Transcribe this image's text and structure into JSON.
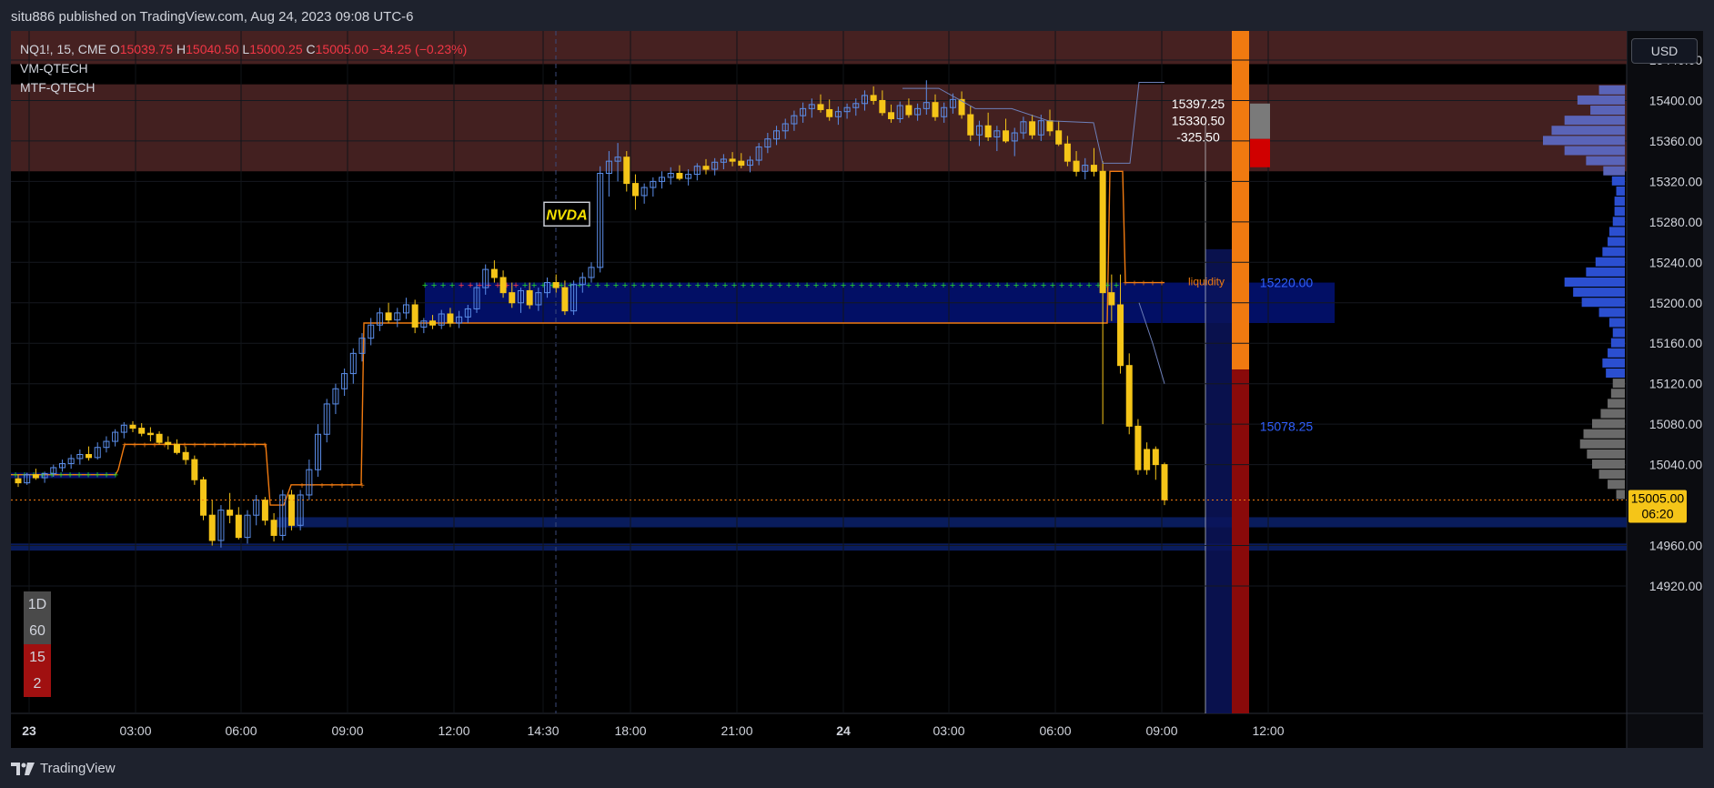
{
  "publisher": "situ886 published on TradingView.com, Aug 24, 2023 09:08 UTC-6",
  "brand": "TradingView",
  "currency_button": "USD",
  "legend": {
    "symbol": "NQ1!, 15, CME",
    "o_label": "O",
    "o": "15039.75",
    "h_label": "H",
    "h": "15040.50",
    "l_label": "L",
    "l": "15000.25",
    "c_label": "C",
    "c": "15005.00",
    "change": "−34.25 (−0.23%)",
    "ind1": "VM-QTECH",
    "ind2": "MTF-QTECH"
  },
  "timeframes": [
    "1D",
    "60",
    "15",
    "2"
  ],
  "timeframe_colors": [
    "#4a4a4a",
    "#4a4a4a",
    "#a01010",
    "#a01010"
  ],
  "colors": {
    "up": "#5b8de8",
    "down": "#f5c518",
    "red_zone": "#4a2323",
    "blue_zone": "#02106a",
    "orange": "#f07a10"
  },
  "chart_data": {
    "type": "candlestick",
    "symbol": "NQ1!",
    "interval": "15",
    "price_axis_labels": [
      "15440.00",
      "15400.00",
      "15360.00",
      "15320.00",
      "15280.00",
      "15240.00",
      "15200.00",
      "15160.00",
      "15120.00",
      "15080.00",
      "15040.00",
      "14960.00",
      "14920.00"
    ],
    "time_axis_labels": [
      "23",
      "03:00",
      "06:00",
      "09:00",
      "12:00",
      "14:30",
      "18:00",
      "21:00",
      "24",
      "03:00",
      "06:00",
      "09:00",
      "12:00"
    ],
    "ylim": [
      14910,
      15470
    ],
    "last_price": "15005.00",
    "countdown": "06:20",
    "annotations": {
      "event_label": "NVDA",
      "liquidity_label": "liquidity",
      "level_1": "15220.00",
      "level_2": "15078.25",
      "measure_top": "15397.25",
      "measure_bottom": "15330.50",
      "measure_diff": "-325.50"
    },
    "candles": [
      [
        15026,
        15030,
        15018,
        15022
      ],
      [
        15022,
        15032,
        15020,
        15030
      ],
      [
        15030,
        15036,
        15025,
        15027
      ],
      [
        15027,
        15033,
        15022,
        15031
      ],
      [
        15031,
        15040,
        15028,
        15037
      ],
      [
        15037,
        15045,
        15033,
        15041
      ],
      [
        15041,
        15050,
        15036,
        15046
      ],
      [
        15046,
        15055,
        15040,
        15050
      ],
      [
        15050,
        15058,
        15044,
        15047
      ],
      [
        15047,
        15062,
        15045,
        15057
      ],
      [
        15057,
        15068,
        15052,
        15063
      ],
      [
        15063,
        15075,
        15058,
        15072
      ],
      [
        15072,
        15082,
        15066,
        15079
      ],
      [
        15079,
        15083,
        15072,
        15076
      ],
      [
        15076,
        15081,
        15068,
        15071
      ],
      [
        15071,
        15077,
        15063,
        15070
      ],
      [
        15070,
        15073,
        15060,
        15062
      ],
      [
        15062,
        15068,
        15055,
        15060
      ],
      [
        15060,
        15065,
        15050,
        15052
      ],
      [
        15052,
        15058,
        15040,
        15045
      ],
      [
        15045,
        15049,
        15020,
        15025
      ],
      [
        15025,
        15028,
        14985,
        14990
      ],
      [
        14990,
        15005,
        14960,
        14965
      ],
      [
        14965,
        15000,
        14958,
        14995
      ],
      [
        14995,
        15012,
        14982,
        14990
      ],
      [
        14990,
        14998,
        14966,
        14968
      ],
      [
        14968,
        14995,
        14962,
        14990
      ],
      [
        14990,
        15010,
        14980,
        15005
      ],
      [
        15005,
        15008,
        14980,
        14985
      ],
      [
        14985,
        14992,
        14964,
        14970
      ],
      [
        14970,
        15015,
        14965,
        15010
      ],
      [
        15010,
        15015,
        14975,
        14980
      ],
      [
        14980,
        15015,
        14975,
        15010
      ],
      [
        15010,
        15045,
        15005,
        15035
      ],
      [
        15035,
        15080,
        15028,
        15070
      ],
      [
        15070,
        15105,
        15062,
        15100
      ],
      [
        15100,
        15120,
        15090,
        15115
      ],
      [
        15115,
        15135,
        15108,
        15130
      ],
      [
        15130,
        15155,
        15120,
        15150
      ],
      [
        15150,
        15170,
        15142,
        15165
      ],
      [
        15165,
        15185,
        15158,
        15178
      ],
      [
        15178,
        15195,
        15172,
        15190
      ],
      [
        15190,
        15200,
        15180,
        15183
      ],
      [
        15183,
        15195,
        15176,
        15190
      ],
      [
        15190,
        15205,
        15184,
        15198
      ],
      [
        15198,
        15203,
        15170,
        15176
      ],
      [
        15176,
        15185,
        15170,
        15182
      ],
      [
        15182,
        15188,
        15174,
        15178
      ],
      [
        15178,
        15193,
        15174,
        15189
      ],
      [
        15189,
        15195,
        15176,
        15180
      ],
      [
        15180,
        15192,
        15175,
        15186
      ],
      [
        15186,
        15198,
        15180,
        15194
      ],
      [
        15194,
        15220,
        15190,
        15215
      ],
      [
        15215,
        15238,
        15208,
        15233
      ],
      [
        15233,
        15242,
        15220,
        15225
      ],
      [
        15225,
        15232,
        15205,
        15210
      ],
      [
        15210,
        15220,
        15195,
        15200
      ],
      [
        15200,
        15215,
        15190,
        15212
      ],
      [
        15212,
        15220,
        15194,
        15198
      ],
      [
        15198,
        15215,
        15192,
        15210
      ],
      [
        15210,
        15225,
        15205,
        15220
      ],
      [
        15220,
        15228,
        15210,
        15215
      ],
      [
        15215,
        15222,
        15188,
        15192
      ],
      [
        15192,
        15222,
        15188,
        15218
      ],
      [
        15218,
        15230,
        15210,
        15225
      ],
      [
        15225,
        15240,
        15220,
        15235
      ],
      [
        15235,
        15335,
        15230,
        15328
      ],
      [
        15328,
        15350,
        15305,
        15340
      ],
      [
        15340,
        15358,
        15320,
        15344
      ],
      [
        15344,
        15350,
        15310,
        15318
      ],
      [
        15318,
        15327,
        15292,
        15306
      ],
      [
        15306,
        15318,
        15298,
        15314
      ],
      [
        15314,
        15324,
        15305,
        15320
      ],
      [
        15320,
        15330,
        15313,
        15324
      ],
      [
        15324,
        15334,
        15317,
        15328
      ],
      [
        15328,
        15336,
        15321,
        15323
      ],
      [
        15323,
        15332,
        15316,
        15327
      ],
      [
        15327,
        15338,
        15321,
        15335
      ],
      [
        15335,
        15342,
        15327,
        15332
      ],
      [
        15332,
        15343,
        15326,
        15339
      ],
      [
        15339,
        15347,
        15332,
        15342
      ],
      [
        15342,
        15349,
        15335,
        15340
      ],
      [
        15340,
        15348,
        15333,
        15336
      ],
      [
        15336,
        15345,
        15329,
        15341
      ],
      [
        15341,
        15358,
        15336,
        15354
      ],
      [
        15354,
        15368,
        15348,
        15362
      ],
      [
        15362,
        15375,
        15356,
        15370
      ],
      [
        15370,
        15382,
        15362,
        15377
      ],
      [
        15377,
        15390,
        15370,
        15385
      ],
      [
        15385,
        15398,
        15378,
        15392
      ],
      [
        15392,
        15402,
        15383,
        15396
      ],
      [
        15396,
        15406,
        15388,
        15391
      ],
      [
        15391,
        15401,
        15380,
        15384
      ],
      [
        15384,
        15394,
        15376,
        15389
      ],
      [
        15389,
        15397,
        15382,
        15393
      ],
      [
        15393,
        15402,
        15385,
        15397
      ],
      [
        15397,
        15410,
        15390,
        15405
      ],
      [
        15405,
        15414,
        15396,
        15400
      ],
      [
        15400,
        15410,
        15385,
        15388
      ],
      [
        15388,
        15396,
        15378,
        15382
      ],
      [
        15382,
        15399,
        15378,
        15395
      ],
      [
        15395,
        15402,
        15383,
        15386
      ],
      [
        15386,
        15397,
        15380,
        15392
      ],
      [
        15392,
        15420,
        15386,
        15398
      ],
      [
        15398,
        15406,
        15380,
        15384
      ],
      [
        15384,
        15398,
        15378,
        15393
      ],
      [
        15393,
        15407,
        15387,
        15401
      ],
      [
        15401,
        15409,
        15382,
        15386
      ],
      [
        15386,
        15395,
        15360,
        15366
      ],
      [
        15366,
        15380,
        15355,
        15375
      ],
      [
        15375,
        15388,
        15360,
        15364
      ],
      [
        15364,
        15375,
        15350,
        15370
      ],
      [
        15370,
        15382,
        15358,
        15360
      ],
      [
        15360,
        15373,
        15345,
        15368
      ],
      [
        15368,
        15384,
        15362,
        15379
      ],
      [
        15379,
        15386,
        15362,
        15366
      ],
      [
        15366,
        15386,
        15360,
        15380
      ],
      [
        15380,
        15391,
        15365,
        15370
      ],
      [
        15370,
        15380,
        15355,
        15357
      ],
      [
        15357,
        15365,
        15335,
        15340
      ],
      [
        15340,
        15350,
        15325,
        15330
      ],
      [
        15330,
        15343,
        15322,
        15336
      ],
      [
        15336,
        15353,
        15325,
        15330
      ],
      [
        15330,
        15340,
        15080,
        15210
      ],
      [
        15210,
        15228,
        15182,
        15198
      ],
      [
        15198,
        15228,
        15130,
        15138
      ],
      [
        15138,
        15150,
        15070,
        15078
      ],
      [
        15078,
        15085,
        15030,
        15035
      ],
      [
        15035,
        15062,
        15030,
        15055
      ],
      [
        15055,
        15058,
        15025,
        15040
      ],
      [
        15040,
        15042,
        15000,
        15005
      ]
    ],
    "volume_profile_bins": [
      {
        "price": 15410,
        "v": 30
      },
      {
        "price": 15400,
        "v": 55
      },
      {
        "price": 15390,
        "v": 40
      },
      {
        "price": 15380,
        "v": 70
      },
      {
        "price": 15370,
        "v": 85
      },
      {
        "price": 15360,
        "v": 95
      },
      {
        "price": 15350,
        "v": 70
      },
      {
        "price": 15340,
        "v": 45
      },
      {
        "price": 15330,
        "v": 25
      },
      {
        "price": 15320,
        "v": 15
      },
      {
        "price": 15310,
        "v": 10
      },
      {
        "price": 15300,
        "v": 12
      },
      {
        "price": 15290,
        "v": 12
      },
      {
        "price": 15280,
        "v": 14
      },
      {
        "price": 15270,
        "v": 18
      },
      {
        "price": 15260,
        "v": 20
      },
      {
        "price": 15250,
        "v": 26
      },
      {
        "price": 15240,
        "v": 34
      },
      {
        "price": 15230,
        "v": 45
      },
      {
        "price": 15220,
        "v": 70
      },
      {
        "price": 15210,
        "v": 60
      },
      {
        "price": 15200,
        "v": 50
      },
      {
        "price": 15190,
        "v": 30
      },
      {
        "price": 15180,
        "v": 18
      },
      {
        "price": 15170,
        "v": 14
      },
      {
        "price": 15160,
        "v": 16
      },
      {
        "price": 15150,
        "v": 20
      },
      {
        "price": 15140,
        "v": 26
      },
      {
        "price": 15130,
        "v": 22
      },
      {
        "price": 15120,
        "v": 14
      },
      {
        "price": 15110,
        "v": 16
      },
      {
        "price": 15100,
        "v": 20
      },
      {
        "price": 15090,
        "v": 28
      },
      {
        "price": 15080,
        "v": 38
      },
      {
        "price": 15070,
        "v": 48
      },
      {
        "price": 15060,
        "v": 52
      },
      {
        "price": 15050,
        "v": 44
      },
      {
        "price": 15040,
        "v": 38
      },
      {
        "price": 15030,
        "v": 30
      },
      {
        "price": 15020,
        "v": 20
      },
      {
        "price": 15010,
        "v": 10
      }
    ]
  }
}
